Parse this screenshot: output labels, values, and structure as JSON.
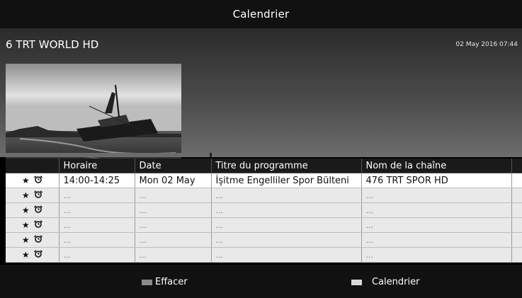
{
  "header": {
    "title": "Calendrier"
  },
  "channel": {
    "name": "6 TRT WORLD HD",
    "datetime": "02 May 2016 07:44"
  },
  "table": {
    "columns": [
      "Horaire",
      "Date",
      "Titre du programme",
      "Nom de la chaîne"
    ],
    "rows": [
      {
        "time": "14:00-14:25",
        "date": "Mon 02 May",
        "title": "İşitme Engelliler Spor Bülteni",
        "channel": "476 TRT SPOR HD"
      },
      {
        "time": "...",
        "date": "...",
        "title": "...",
        "channel": "..."
      },
      {
        "time": "...",
        "date": "...",
        "title": "...",
        "channel": "..."
      },
      {
        "time": "...",
        "date": "...",
        "title": "...",
        "channel": "..."
      },
      {
        "time": "...",
        "date": "...",
        "title": "...",
        "channel": "..."
      },
      {
        "time": "...",
        "date": "...",
        "title": "...",
        "channel": "..."
      }
    ],
    "row_icons": [
      "star-icon",
      "alarm-clock-icon"
    ]
  },
  "footer": {
    "actions": [
      {
        "label": "Effacer",
        "color": "#8a8a8a"
      },
      {
        "label": "Calendrier",
        "color": "#d9d9d9"
      }
    ]
  }
}
